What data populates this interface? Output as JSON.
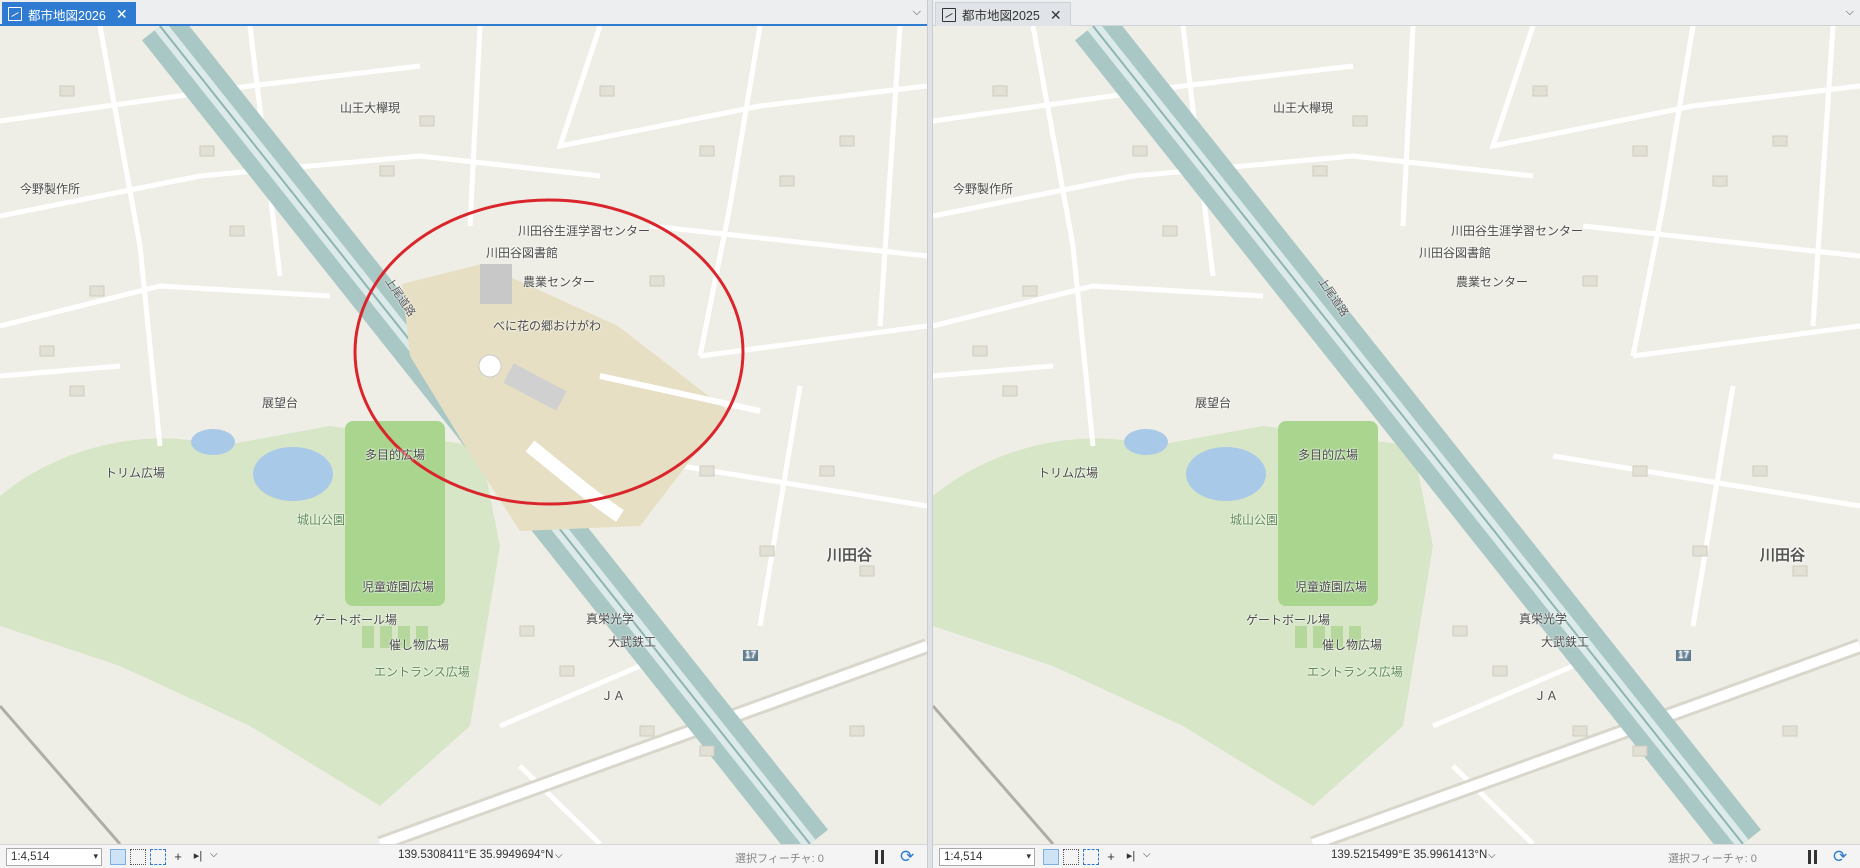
{
  "panes": [
    {
      "tab": {
        "title": "都市地図2026",
        "active": true,
        "icon": "map-icon"
      },
      "status": {
        "scale": "1:4,514",
        "coordinates": "139.5308411°E 35.9949694°N",
        "selected_features": "選択フィーチャ: 0"
      },
      "highlight": {
        "shape": "red-ellipse",
        "color": "#d9252b"
      },
      "development_area_visible": true
    },
    {
      "tab": {
        "title": "都市地図2025",
        "active": false,
        "icon": "map-icon"
      },
      "status": {
        "scale": "1:4,514",
        "coordinates": "139.5215499°E 35.9961413°N",
        "selected_features": "選択フィーチャ: 0"
      },
      "development_area_visible": false
    }
  ],
  "map_labels": {
    "sanno": "山王大欅現",
    "imano": "今野製作所",
    "center": "川田谷生涯学習センター",
    "library": "川田谷図書館",
    "agri": "農業センター",
    "benibana": "べに花の郷おけがわ",
    "tenbo": "展望台",
    "trim": "トリム広場",
    "tamokuteki": "多目的広場",
    "shiroyama": "城山公園",
    "jido": "児童遊園広場",
    "gate": "ゲートボール場",
    "moyoshi": "催し物広場",
    "entrance": "エントランス広場",
    "shinko": "真栄光学",
    "daibu": "大武鉄工",
    "ja": "ＪＡ",
    "kawataya": "川田谷",
    "road": "上尾道路",
    "route": "17"
  },
  "colors": {
    "accent": "#2e7bd1",
    "map_bg": "#efeee6",
    "park": "#d6e6c6",
    "field": "#a9d58f",
    "pond": "#a9c9e8",
    "expressway": "#a9c7c4",
    "development": "#e6dfc4",
    "highlight": "#d9252b"
  }
}
